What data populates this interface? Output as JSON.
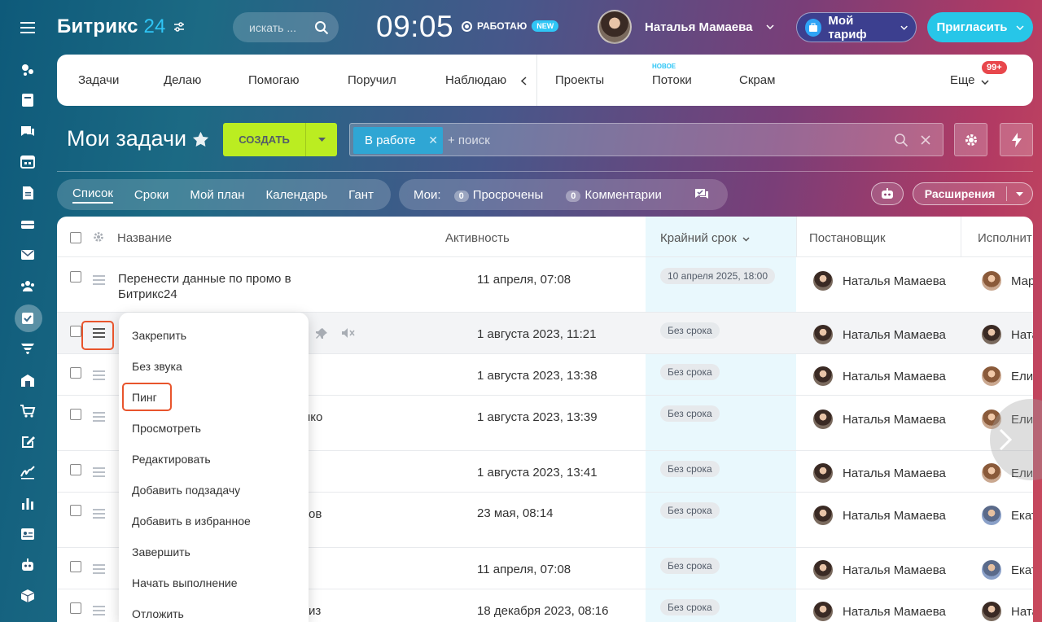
{
  "header": {
    "logo_text": "Битрикс",
    "logo_num": "24",
    "search_placeholder": "искать ...",
    "clock": "09:05",
    "work_status": "РАБОТАЮ",
    "work_badge": "NEW",
    "user_name": "Наталья Мамаева",
    "tariff_label": "Мой тариф",
    "invite_label": "Пригласить"
  },
  "topnav": {
    "items": [
      "Задачи",
      "Делаю",
      "Помогаю",
      "Поручил",
      "Наблюдаю",
      "Проекты",
      "Потоки",
      "Скрам"
    ],
    "new_label": "НОВОЕ",
    "more_label": "Еще",
    "badge": "99+"
  },
  "page": {
    "title": "Мои задачи",
    "create_label": "СОЗДАТЬ",
    "filter_chip": "В работе",
    "filter_placeholder": "+ поиск"
  },
  "views": {
    "items": [
      "Список",
      "Сроки",
      "Мой план",
      "Календарь",
      "Гант"
    ]
  },
  "mine": {
    "label": "Мои:",
    "overdue_count": "0",
    "overdue_label": "Просрочены",
    "comments_count": "0",
    "comments_label": "Комментарии"
  },
  "extensions_label": "Расширения",
  "columns": {
    "name": "Название",
    "activity": "Активность",
    "deadline": "Крайний срок",
    "creator": "Постановщик",
    "executor": "Исполнит"
  },
  "rows": [
    {
      "name": "Перенести данные по промо в Битрикс24",
      "activity": "11 апреля, 07:08",
      "deadline": "10 апреля 2025, 18:00",
      "creator": "Наталья Мамаева",
      "executor": "Мар"
    },
    {
      "name": "",
      "activity": "1 августа 2023, 11:21",
      "deadline": "Без срока",
      "creator": "Наталья Мамаева",
      "executor": "Ната"
    },
    {
      "name": "",
      "activity": "1 августа 2023, 13:38",
      "deadline": "Без срока",
      "creator": "Наталья Мамаева",
      "executor": "Елиз"
    },
    {
      "name": "нко",
      "activity": "1 августа 2023, 13:39",
      "deadline": "Без срока",
      "creator": "Наталья Мамаева",
      "executor": "Елиз"
    },
    {
      "name": "",
      "activity": "1 августа 2023, 13:41",
      "deadline": "Без срока",
      "creator": "Наталья Мамаева",
      "executor": "Елиз"
    },
    {
      "name": "ов",
      "activity": "23 мая, 08:14",
      "deadline": "Без срока",
      "creator": "Наталья Мамаева",
      "executor": "Екат"
    },
    {
      "name": "",
      "activity": "11 апреля, 07:08",
      "deadline": "Без срока",
      "creator": "Наталья Мамаева",
      "executor": "Екат"
    },
    {
      "name": "из",
      "activity": "18 декабря 2023, 08:16",
      "deadline": "Без срока",
      "creator": "Наталья Мамаева",
      "executor": "Ната"
    }
  ],
  "context_menu": [
    "Закрепить",
    "Без звука",
    "Пинг",
    "Просмотреть",
    "Редактировать",
    "Добавить подзадачу",
    "Добавить в избранное",
    "Завершить",
    "Начать выполнение",
    "Отложить"
  ],
  "colors": {
    "accent": "#2fc6f6",
    "create_btn": "#bbed21",
    "highlight": "#e8542c"
  }
}
